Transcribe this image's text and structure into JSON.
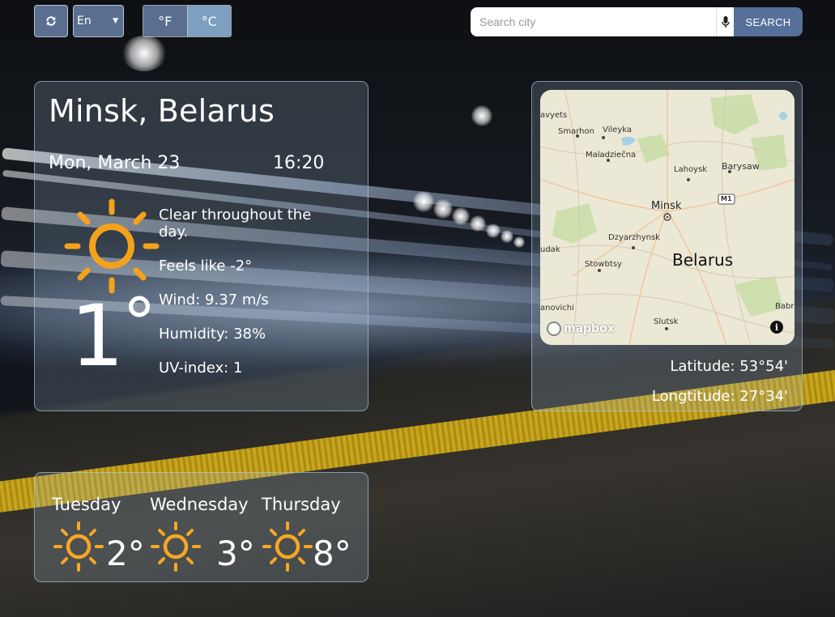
{
  "toolbar": {
    "refresh_icon": "refresh-icon",
    "language": "En",
    "unit_f": "°F",
    "unit_c": "°C",
    "active_unit": "C",
    "search": {
      "placeholder": "Search city",
      "value": "",
      "mic_icon": "microphone-icon",
      "button_label": "SEARCH"
    }
  },
  "current": {
    "location": "Minsk, Belarus",
    "date": "Mon, March 23",
    "time": "16:20",
    "temperature": "1",
    "degree_sign": "°",
    "icon": "sun-icon",
    "description": "Clear throughout the day.",
    "feels_like": "Feels like -2°",
    "wind": "Wind: 9.37 m/s",
    "humidity": "Humidity: 38%",
    "uv_index": "UV-index: 1"
  },
  "map": {
    "country": "Belarus",
    "capital": "Minsk",
    "towns": [
      "avyets",
      "Smarhon",
      "Vileyka",
      "Maladziečna",
      "Lahoysk",
      "Barysaw",
      "Dzyarzhynsk",
      "udak",
      "Stowbtsy",
      "anovichi",
      "Slutsk",
      "Babr"
    ],
    "road_badge": "M1",
    "attribution": "mapbox",
    "info_icon": "info-icon",
    "latitude": "Latitude: 53°54'",
    "longitude": "Longtitude: 27°34'"
  },
  "forecast": [
    {
      "day": "Tuesday",
      "temp": "2°",
      "icon": "sun-icon"
    },
    {
      "day": "Wednesday",
      "temp": "3°",
      "icon": "sun-icon"
    },
    {
      "day": "Thursday",
      "temp": "8°",
      "icon": "sun-icon"
    }
  ],
  "colors": {
    "sun_large": "#f5a21b",
    "sun_small": "#f6a723",
    "button_bg": "#5a6f8f",
    "search_button_bg": "#56709a",
    "card_border": "#aac8e1"
  }
}
